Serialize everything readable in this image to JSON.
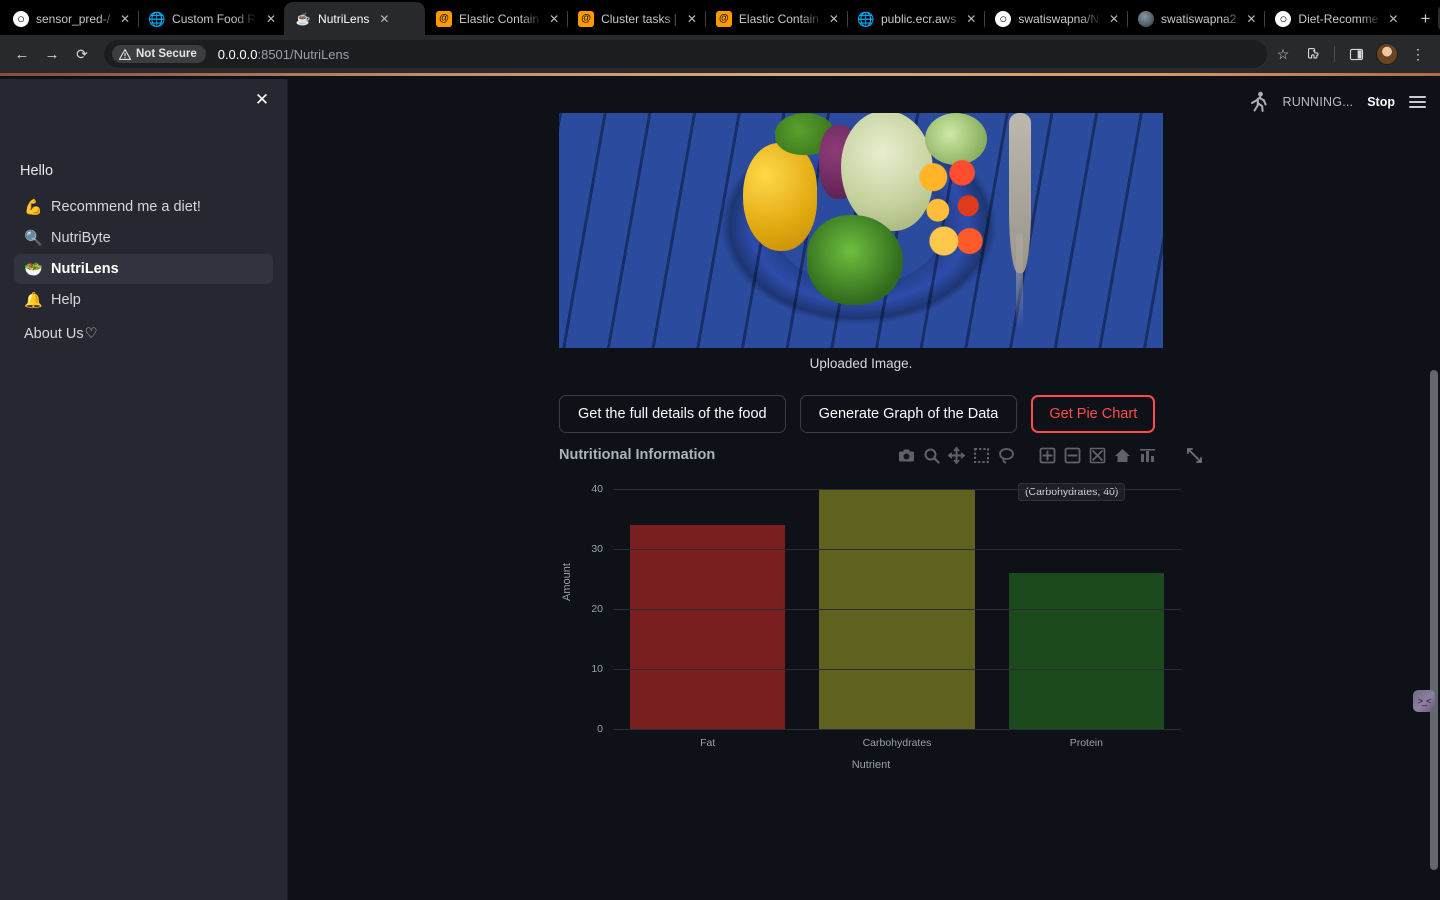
{
  "browser": {
    "tabs": [
      {
        "title": "sensor_pred-/",
        "favicon": "github-icon",
        "active": false
      },
      {
        "title": "Custom Food R",
        "favicon": "globe-icon",
        "active": false
      },
      {
        "title": "NutriLens",
        "favicon": "nutrilens-icon",
        "active": true
      },
      {
        "title": "Elastic Contain",
        "favicon": "aws-icon",
        "active": false
      },
      {
        "title": "Cluster tasks |",
        "favicon": "aws-icon",
        "active": false
      },
      {
        "title": "Elastic Contain",
        "favicon": "aws-icon",
        "active": false
      },
      {
        "title": "public.ecr.aws",
        "favicon": "globe-icon",
        "active": false
      },
      {
        "title": "swatiswapna/N",
        "favicon": "github-icon",
        "active": false
      },
      {
        "title": "swatiswapna2",
        "favicon": "circle-icon",
        "active": false
      },
      {
        "title": "Diet-Recomme",
        "favicon": "github-icon",
        "active": false
      }
    ],
    "new_tab_label": "+",
    "tab_close_label": "✕",
    "tab_list_label": "⌄",
    "toolbar": {
      "back_label": "←",
      "forward_label": "→",
      "reload_label": "⟳",
      "security_label": "Not Secure",
      "url_host": "0.0.0.0",
      "url_path": ":8501/NutriLens",
      "bookmark_label": "☆",
      "extensions_label": "extensions-icon",
      "side_panel_label": "side-panel-icon",
      "profile_label": "profile-avatar",
      "menu_label": "⋮"
    }
  },
  "sidebar": {
    "close_label": "✕",
    "greeting": "Hello",
    "items": [
      {
        "emoji": "💪",
        "label": "Recommend me a diet!",
        "icon": "muscle-icon",
        "active": false
      },
      {
        "emoji": "🔍",
        "label": "NutriByte",
        "icon": "magnifier-icon",
        "active": false
      },
      {
        "emoji": "🥗",
        "label": "NutriLens",
        "icon": "salad-icon",
        "active": true
      },
      {
        "emoji": "🔔",
        "label": "Help",
        "icon": "bell-icon",
        "active": false
      }
    ],
    "about_label": "About Us",
    "about_heart": "♡"
  },
  "app_topbar": {
    "status_text": "RUNNING...",
    "stop_label": "Stop",
    "menu_label": "main-menu"
  },
  "main": {
    "image_caption": "Uploaded Image.",
    "buttons": [
      {
        "label": "Get the full details of the food",
        "variant": "default"
      },
      {
        "label": "Generate Graph of the Data",
        "variant": "default"
      },
      {
        "label": "Get Pie Chart",
        "variant": "danger"
      }
    ],
    "modebar_icons": [
      "camera-icon",
      "zoom-icon",
      "pan-icon",
      "box-select-icon",
      "lasso-select-icon",
      "zoom-in-icon",
      "zoom-out-icon",
      "autoscale-icon",
      "reset-axes-icon",
      "toggle-spikelines-icon"
    ],
    "modebar_expand_icon": "expand-icon",
    "hover_label": "(Carbohydrates, 40)"
  },
  "colors": {
    "accent_danger": "#ff4b4b",
    "sidebar_bg": "#262730",
    "app_bg": "#0e1117",
    "fat": "#7a1f1f",
    "carbohydrates": "#5e621e",
    "protein": "#1c4a1c"
  },
  "chart_data": {
    "type": "bar",
    "title": "Nutritional Information",
    "xlabel": "Nutrient",
    "ylabel": "Amount",
    "categories": [
      "Fat",
      "Carbohydrates",
      "Protein"
    ],
    "values": [
      34,
      40,
      26
    ],
    "colors": [
      "#7a1f1f",
      "#5e621e",
      "#1c4a1c"
    ],
    "ylim": [
      0,
      40
    ],
    "yticks": [
      0,
      10,
      20,
      30,
      40
    ],
    "grid": true,
    "legend": "none",
    "annotation": "(Carbohydrates, 40)"
  },
  "right_rail": {
    "widget_label": ">_<"
  }
}
